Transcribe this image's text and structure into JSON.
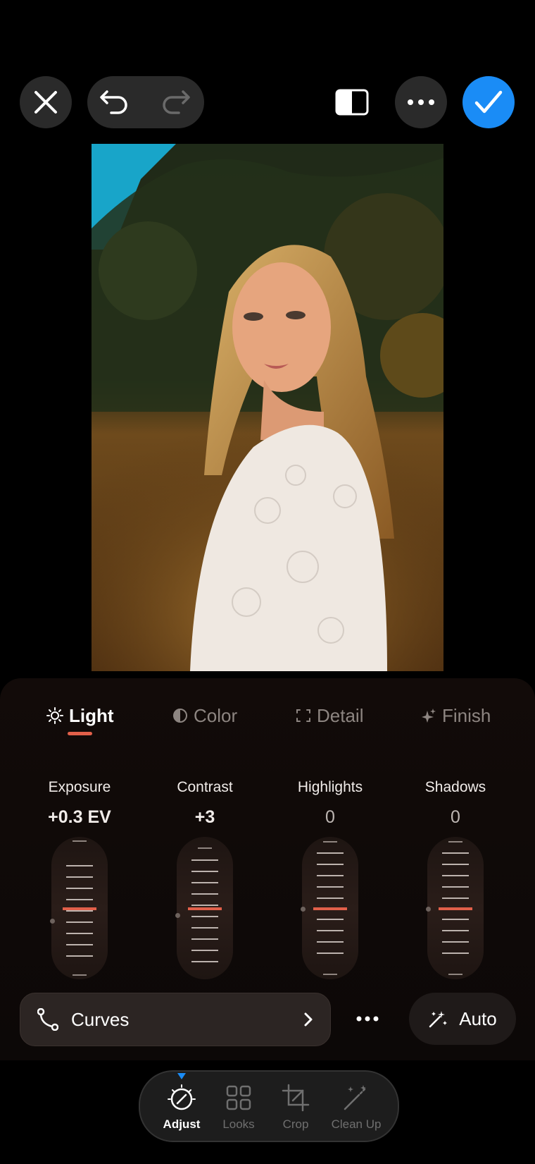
{
  "toolbar": {
    "close_icon": "close-icon",
    "undo_icon": "undo-icon",
    "redo_icon": "redo-icon",
    "compare_icon": "compare-icon",
    "more_icon": "more-icon",
    "done_icon": "checkmark-icon",
    "accent": "#1a8cf6"
  },
  "tabs": [
    {
      "label": "Light",
      "icon": "sun-icon",
      "active": true
    },
    {
      "label": "Color",
      "icon": "half-circle-icon",
      "active": false
    },
    {
      "label": "Detail",
      "icon": "focus-frame-icon",
      "active": false
    },
    {
      "label": "Finish",
      "icon": "sparkle-icon",
      "active": false
    }
  ],
  "sliders": [
    {
      "label": "Exposure",
      "value": "+0.3 EV"
    },
    {
      "label": "Contrast",
      "value": "+3"
    },
    {
      "label": "Highlights",
      "value": "0"
    },
    {
      "label": "Shadows",
      "value": "0"
    }
  ],
  "curves": {
    "label": "Curves",
    "icon": "curve-icon"
  },
  "more_options_icon": "more-icon",
  "auto": {
    "label": "Auto",
    "icon": "magic-wand-icon"
  },
  "bottom_nav": [
    {
      "label": "Adjust",
      "icon": "adjust-dial-icon",
      "active": true
    },
    {
      "label": "Looks",
      "icon": "grid-icon",
      "active": false
    },
    {
      "label": "Crop",
      "icon": "crop-icon",
      "active": false
    },
    {
      "label": "Clean Up",
      "icon": "wand-icon",
      "active": false
    }
  ],
  "colors": {
    "active_accent": "#e2604a",
    "nav_indicator": "#1a8cf6"
  }
}
